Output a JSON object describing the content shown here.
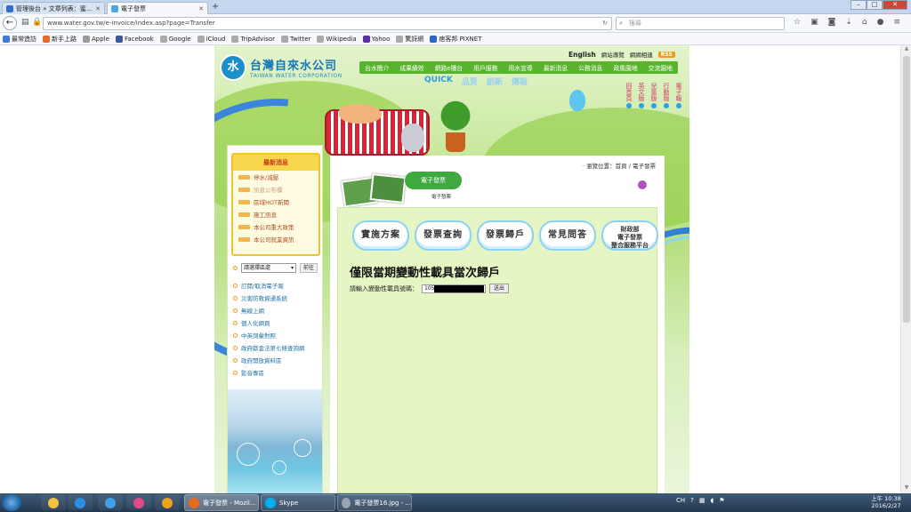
{
  "browser": {
    "tabs": [
      {
        "title": "管理後台 » 文章列表：蜜...",
        "color": "#2d6fd6"
      },
      {
        "title": "電子發票",
        "color": "#4aa7e4"
      }
    ],
    "url": "www.water.gov.tw/e-invoice/index.asp?page=Transfer",
    "search_placeholder": "搜尋",
    "bookmarks": [
      {
        "label": "最常造訪",
        "color": "#3f7ad8"
      },
      {
        "label": "新手上路",
        "color": "#e8672b"
      },
      {
        "label": "Apple",
        "color": "#999999"
      },
      {
        "label": "Facebook",
        "color": "#3b5998"
      },
      {
        "label": "Google",
        "color": "#aaaaaa"
      },
      {
        "label": "iCloud",
        "color": "#aaaaaa"
      },
      {
        "label": "TripAdvisor",
        "color": "#aaaaaa"
      },
      {
        "label": "Twitter",
        "color": "#aaaaaa"
      },
      {
        "label": "Wikipedia",
        "color": "#aaaaaa"
      },
      {
        "label": "Yahoo",
        "color": "#5f2ca8"
      },
      {
        "label": "驚訝網",
        "color": "#aaaaaa"
      },
      {
        "label": "痞客邦 PIXNET",
        "color": "#2a66c8"
      }
    ]
  },
  "site": {
    "logo_cn": "台灣自來水公司",
    "logo_en": "TAIWAN WATER CORPORATION",
    "logo_mark": "水",
    "top_links": [
      "English",
      "網站導覽",
      "網網相連",
      "RSS"
    ],
    "main_nav": [
      "台水簡介",
      "成果績效",
      "網路e櫃台",
      "用戶服務",
      "用水宣導",
      "最新消息",
      "公務消息",
      "政風園地",
      "交流園地"
    ],
    "quick": [
      "QUICK",
      "品質",
      "創新",
      "傳報"
    ],
    "side_vertical": [
      "回首頁",
      "英文版",
      "兒童版",
      "行動版",
      "電子報"
    ],
    "news_title": "最新消息",
    "news_items": [
      {
        "label": "停水/減壓",
        "dim": false
      },
      {
        "label": "訊息公布欄",
        "dim": true
      },
      {
        "label": "區域HOT新聞",
        "dim": false
      },
      {
        "label": "施工訊息",
        "dim": false
      },
      {
        "label": "本公司重大政策",
        "dim": false
      },
      {
        "label": "本公司就業資訊",
        "dim": false
      }
    ],
    "select_placeholder": "請選擇區處",
    "go_label": "前往",
    "side_links": [
      "訂閱/取消電子報",
      "災害防救資通系統",
      "無線上網",
      "個人化網頁",
      "中英詞彙對照",
      "政府獻金法第七條查詢網",
      "政府開放資料區",
      "影音專區"
    ],
    "breadcrumb": "‧ 瀏覽位置：首頁 / 電子發票",
    "badge": "電子發票",
    "badge_sub": "電子發票",
    "clouds": [
      "實施方案",
      "發票查詢",
      "發票歸戶",
      "常見問答"
    ],
    "cloud_multi": [
      "財政部",
      "電子發票",
      "整合服務平台"
    ],
    "form_title": "僅限當期變動性載具當次歸戶",
    "form_label": "請輸入變動性載具號碼：",
    "vin_value": "105",
    "submit_label": "送出"
  },
  "taskbar": {
    "apps": [
      {
        "label": "電子發票 - Mozil...",
        "color": "#e66b1f",
        "active": true
      },
      {
        "label": "Skype",
        "color": "#00aff0",
        "active": false
      },
      {
        "label": "電子發票16.jpg - ...",
        "color": "#9aa3ae",
        "active": false
      }
    ],
    "pins": [
      {
        "name": "explorer-pin-icon",
        "color": "#f3c23f"
      },
      {
        "name": "ie-pin-icon",
        "color": "#2d8fe0"
      },
      {
        "name": "network-pin-icon",
        "color": "#3fa0e8"
      },
      {
        "name": "picasa-pin-icon",
        "color": "#e34b86"
      },
      {
        "name": "chrome-pin-icon",
        "color": "#e8a41a"
      }
    ],
    "tray_text": "CH",
    "time": "上午 10:38",
    "date": "2016/2/27"
  }
}
